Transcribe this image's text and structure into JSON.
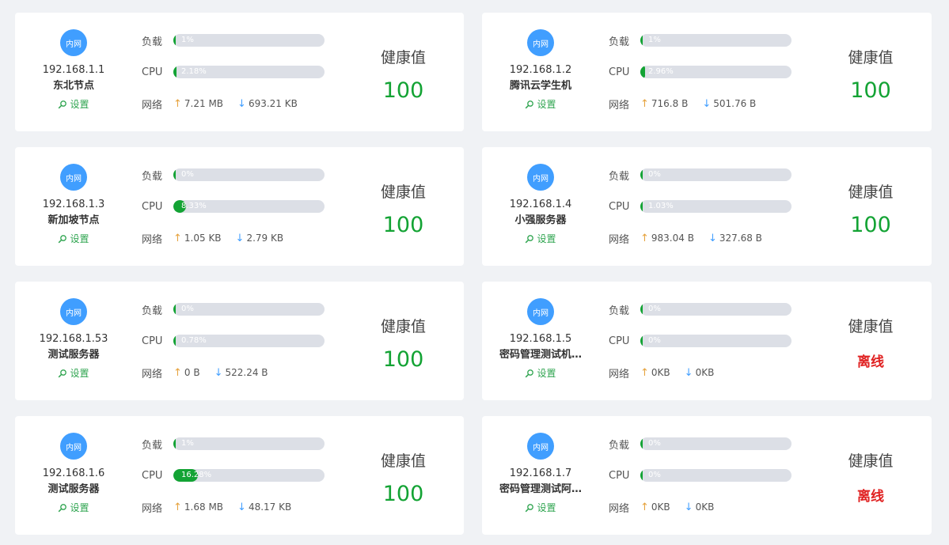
{
  "common": {
    "badge_label": "内网",
    "setting_label": "设置",
    "load_label": "负载",
    "cpu_label": "CPU",
    "net_label": "网络",
    "health_label": "健康值",
    "offline_label": "离线",
    "up_icon": "arrow-up-icon",
    "down_icon": "arrow-down-icon",
    "colors": {
      "ok": "#13a334",
      "offline": "#e02020",
      "badge": "#409eff",
      "up": "#e6a23c",
      "down": "#409eff"
    }
  },
  "servers": [
    {
      "ip": "192.168.1.1",
      "name": "东北节点",
      "load_text": "1%",
      "load": 1,
      "cpu_text": "2.18%",
      "cpu": 2.18,
      "up": "7.21 MB",
      "down": "693.21 KB",
      "health": "100",
      "offline": false
    },
    {
      "ip": "192.168.1.2",
      "name": "腾讯云学生机",
      "load_text": "1%",
      "load": 1,
      "cpu_text": "2.96%",
      "cpu": 2.96,
      "up": "716.8 B",
      "down": "501.76 B",
      "health": "100",
      "offline": false
    },
    {
      "ip": "192.168.1.3",
      "name": "新加坡节点",
      "load_text": "0%",
      "load": 0,
      "cpu_text": "8.33%",
      "cpu": 8.33,
      "up": "1.05 KB",
      "down": "2.79 KB",
      "health": "100",
      "offline": false
    },
    {
      "ip": "192.168.1.4",
      "name": "小强服务器",
      "load_text": "0%",
      "load": 0,
      "cpu_text": "1.03%",
      "cpu": 1.03,
      "up": "983.04 B",
      "down": "327.68 B",
      "health": "100",
      "offline": false
    },
    {
      "ip": "192.168.1.53",
      "name": "测试服务器",
      "load_text": "0%",
      "load": 0,
      "cpu_text": "0.78%",
      "cpu": 0.78,
      "up": "0 B",
      "down": "522.24 B",
      "health": "100",
      "offline": false
    },
    {
      "ip": "192.168.1.5",
      "name": "密码管理测试机…",
      "load_text": "0%",
      "load": 0,
      "cpu_text": "0%",
      "cpu": 0,
      "up": "0KB",
      "down": "0KB",
      "health": "",
      "offline": true
    },
    {
      "ip": "192.168.1.6",
      "name": "测试服务器",
      "load_text": "1%",
      "load": 1,
      "cpu_text": "16.28%",
      "cpu": 16.28,
      "up": "1.68 MB",
      "down": "48.17 KB",
      "health": "100",
      "offline": false
    },
    {
      "ip": "192.168.1.7",
      "name": "密码管理测试阿…",
      "load_text": "0%",
      "load": 0,
      "cpu_text": "0%",
      "cpu": 0,
      "up": "0KB",
      "down": "0KB",
      "health": "",
      "offline": true
    }
  ]
}
